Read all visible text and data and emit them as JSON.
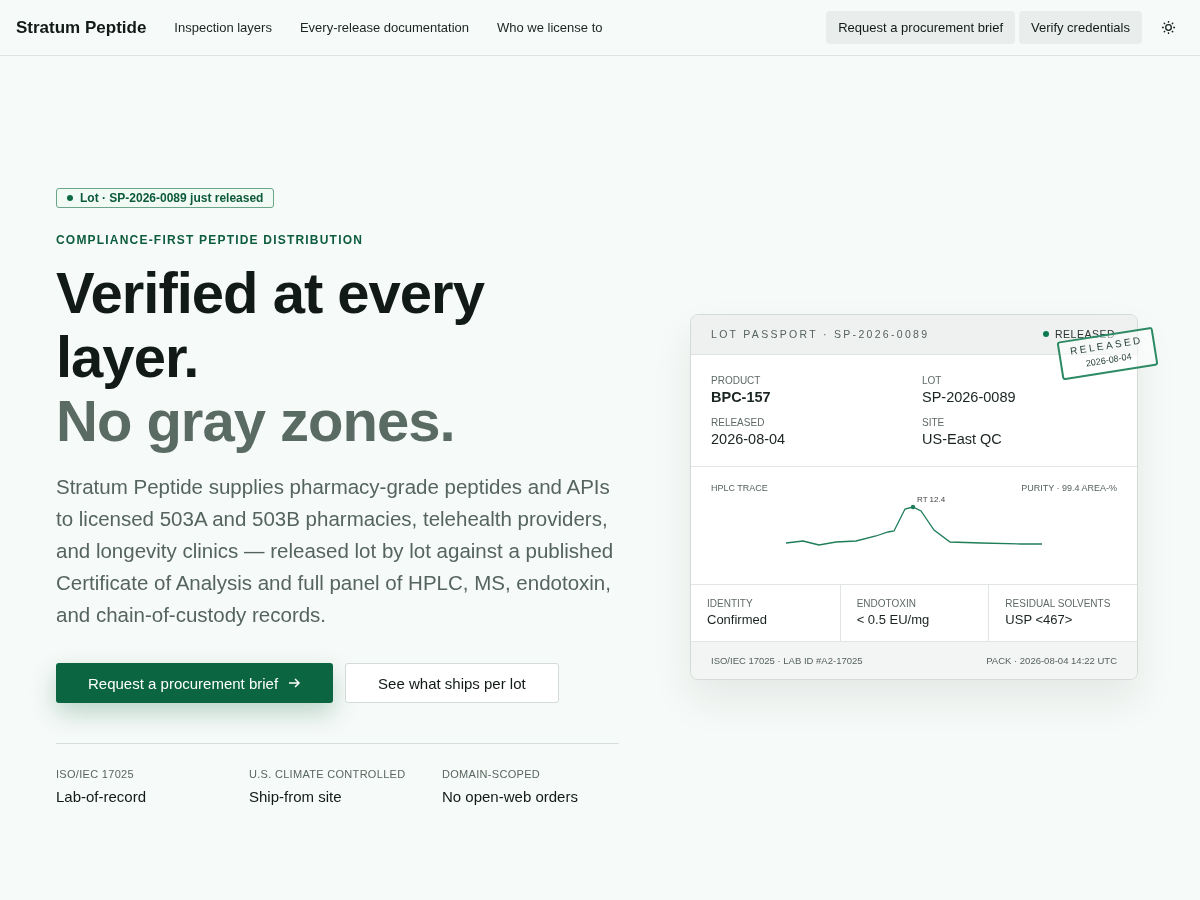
{
  "nav": {
    "brand": "Stratum Peptide",
    "links": [
      "Inspection layers",
      "Every-release documentation",
      "Who we license to"
    ],
    "buttons": [
      "Request a procurement brief",
      "Verify credentials"
    ]
  },
  "hero": {
    "badge": "Lot · SP-2026-0089 just released",
    "eyebrow": "COMPLIANCE-FIRST PEPTIDE DISTRIBUTION",
    "headline": "Verified at every layer.",
    "headline_muted": "No gray zones.",
    "lede": "Stratum Peptide supplies pharmacy-grade peptides and APIs to licensed 503A and 503B pharmacies, telehealth providers, and longevity clinics — released lot by lot against a published Certificate of Analysis and full panel of HPLC, MS, endotoxin, and chain-of-custody records.",
    "buttons": [
      {
        "label": "Request a procurement brief",
        "kind": "primary"
      },
      {
        "label": "See what ships per lot",
        "kind": "secondary"
      }
    ],
    "facts": [
      {
        "label": "ISO/IEC 17025",
        "value": "Lab-of-record"
      },
      {
        "label": "U.S. CLIMATE CONTROLLED",
        "value": "Ship-from site"
      },
      {
        "label": "DOMAIN-SCOPED",
        "value": "No open-web orders"
      }
    ]
  },
  "passport": {
    "title": "LOT PASSPORT · SP-2026-0089",
    "status": "RELEASED",
    "stamp": {
      "label": "RELEASED",
      "date": "2026-08-04"
    },
    "fields": [
      {
        "label": "PRODUCT",
        "value": "BPC-157",
        "bold": true
      },
      {
        "label": "LOT",
        "value": "SP-2026-0089",
        "bold": false
      },
      {
        "label": "RELEASED",
        "value": "2026-08-04",
        "bold": false
      },
      {
        "label": "SITE",
        "value": "US-East QC",
        "bold": false
      }
    ],
    "trace": {
      "title": "HPLC TRACE",
      "purity": "PURITY · 99.4 AREA-%",
      "peak_label": "RT 12.4"
    },
    "tests": [
      {
        "label": "IDENTITY",
        "value": "Confirmed"
      },
      {
        "label": "ENDOTOXIN",
        "value": "< 0.5 EU/mg"
      },
      {
        "label": "RESIDUAL SOLVENTS",
        "value": "USP <467>"
      }
    ],
    "footer": {
      "left": "ISO/IEC 17025 · LAB ID #A2-17025",
      "right": "PACK · 2026-08-04 14:22 UTC"
    }
  }
}
